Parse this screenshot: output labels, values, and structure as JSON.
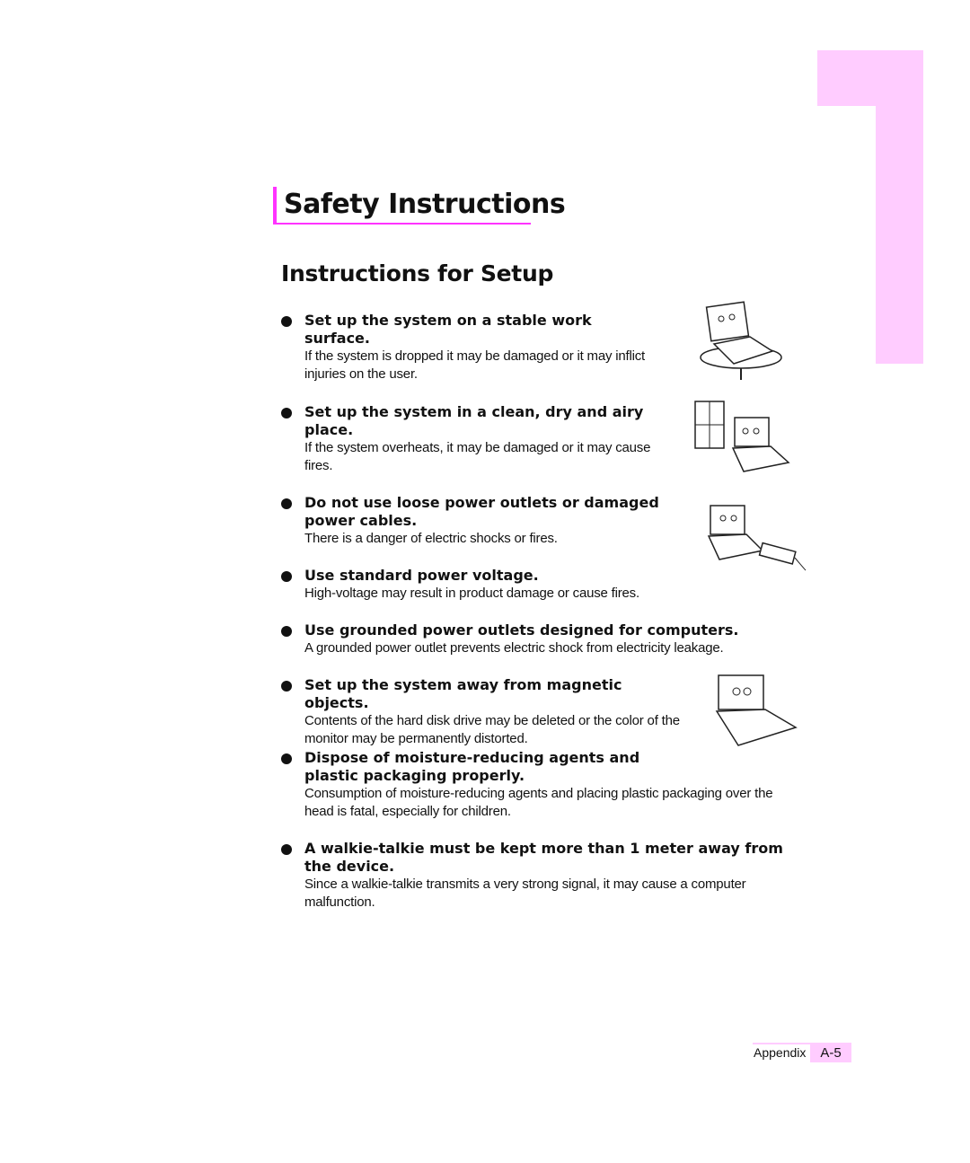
{
  "page": {
    "title": "Safety Instructions",
    "subtitle": "Instructions for Setup",
    "accent_color": "#ff33ff",
    "tab_color": "#ffccff"
  },
  "items": [
    {
      "head": "Set up the system on a stable work surface.",
      "body": "If the system is dropped it may be damaged or it may inflict injuries on the user.",
      "icon": "laptop-falling-icon"
    },
    {
      "head": "Set up the system in a clean, dry and airy place.",
      "body": "If the system overheats, it may be damaged or it may cause fires.",
      "icon": "laptop-window-icon"
    },
    {
      "head": "Do not use loose power outlets or damaged power cables.",
      "body": "There is a danger of electric shocks or fires.",
      "icon": "laptop-power-strip-icon"
    },
    {
      "head": "Use standard power voltage.",
      "body": "High-voltage may result in product damage or cause fires."
    },
    {
      "head": "Use grounded power outlets designed for computers.",
      "body": "A grounded power outlet prevents electric shock from electricity leakage."
    },
    {
      "head": "Set up the system away from magnetic objects.",
      "body": "Contents of the hard disk drive may be deleted or the color of the monitor may be permanently distorted.",
      "icon": "laptop-magnet-icon"
    },
    {
      "head": "Dispose of moisture-reducing agents and plastic packaging properly.",
      "body": "Consumption of moisture-reducing agents and placing plastic packaging over the head is fatal, especially for children."
    },
    {
      "head": "A walkie-talkie must be kept more than 1 meter away from the device.",
      "body": "Since a walkie-talkie transmits a very strong signal, it may cause a computer malfunction."
    }
  ],
  "footer": {
    "section": "Appendix",
    "page": "A-5"
  }
}
